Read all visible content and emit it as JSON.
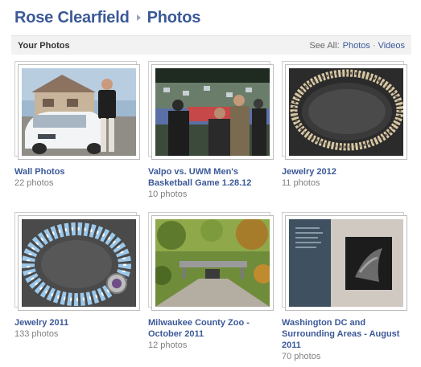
{
  "header": {
    "name": "Rose Clearfield",
    "section": "Photos"
  },
  "bar": {
    "title": "Your Photos",
    "see_all": "See All:",
    "photos_link": "Photos",
    "separator": "·",
    "videos_link": "Videos"
  },
  "albums": [
    {
      "title": "Wall Photos",
      "count": "22 photos"
    },
    {
      "title": "Valpo vs. UWM Men's Basketball Game 1.28.12",
      "count": "10 photos"
    },
    {
      "title": "Jewelry 2012",
      "count": "11 photos"
    },
    {
      "title": "Jewelry 2011",
      "count": "133 photos"
    },
    {
      "title": "Milwaukee County Zoo - October 2011",
      "count": "12 photos"
    },
    {
      "title": "Washington DC and Surrounding Areas - August 2011",
      "count": "70 photos"
    }
  ]
}
